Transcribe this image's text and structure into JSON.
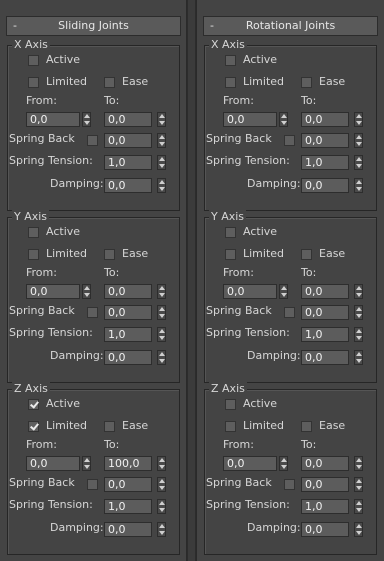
{
  "panels": [
    {
      "title": "Sliding Joints",
      "groups": [
        {
          "axis": "X Axis",
          "active": false,
          "limited": false,
          "ease": false,
          "from": "0,0",
          "to": "0,0",
          "spring_back": "0,0",
          "spring_back_checked": false,
          "spring_tension": "1,0",
          "damping": "0,0"
        },
        {
          "axis": "Y Axis",
          "active": false,
          "limited": false,
          "ease": false,
          "from": "0,0",
          "to": "0,0",
          "spring_back": "0,0",
          "spring_back_checked": false,
          "spring_tension": "1,0",
          "damping": "0,0"
        },
        {
          "axis": "Z Axis",
          "active": true,
          "limited": true,
          "ease": false,
          "from": "0,0",
          "to": "100,0",
          "spring_back": "0,0",
          "spring_back_checked": false,
          "spring_tension": "1,0",
          "damping": "0,0"
        }
      ]
    },
    {
      "title": "Rotational Joints",
      "groups": [
        {
          "axis": "X Axis",
          "active": false,
          "limited": false,
          "ease": false,
          "from": "0,0",
          "to": "0,0",
          "spring_back": "0,0",
          "spring_back_checked": false,
          "spring_tension": "1,0",
          "damping": "0,0"
        },
        {
          "axis": "Y Axis",
          "active": false,
          "limited": false,
          "ease": false,
          "from": "0,0",
          "to": "0,0",
          "spring_back": "0,0",
          "spring_back_checked": false,
          "spring_tension": "1,0",
          "damping": "0,0"
        },
        {
          "axis": "Z Axis",
          "active": false,
          "limited": false,
          "ease": false,
          "from": "0,0",
          "to": "0,0",
          "spring_back": "0,0",
          "spring_back_checked": false,
          "spring_tension": "1,0",
          "damping": "0,0"
        }
      ]
    }
  ],
  "labels": {
    "collapse": "-",
    "active": "Active",
    "limited": "Limited",
    "ease": "Ease",
    "from": "From:",
    "to": "To:",
    "spring_back": "Spring Back",
    "spring_tension": "Spring Tension:",
    "damping": "Damping:"
  }
}
